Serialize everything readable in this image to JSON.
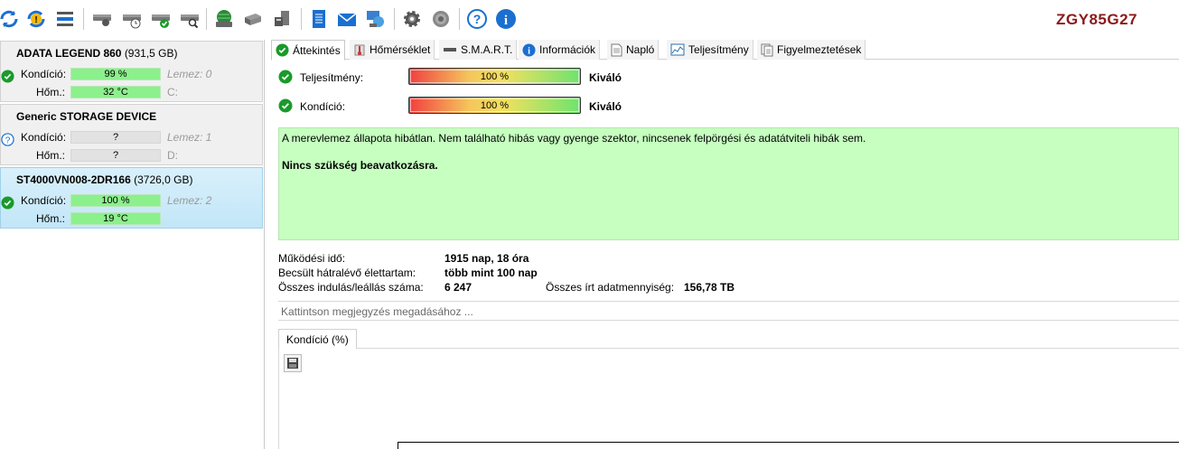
{
  "brand": "ZGY85G27",
  "toolbar": {
    "icons": [
      "refresh-icon",
      "refresh-warning-icon",
      "drive-list-icon",
      "drive-settings-icon",
      "drive-schedule-icon",
      "drive-check-icon",
      "drive-search-icon",
      "globe-drive-icon",
      "drive-tools-icon",
      "drive-cleanup-icon",
      "notes-icon",
      "email-icon",
      "network-icon",
      "gear-icon",
      "sound-icon",
      "help-icon",
      "info-icon"
    ]
  },
  "disks": [
    {
      "name": "ADATA LEGEND 860",
      "size": "(931,5 GB)",
      "status": "ok",
      "condition_label": "Kondíció:",
      "condition_value": "99 %",
      "temp_label": "Hőm.:",
      "temp_value": "32 °C",
      "disk_label": "Lemez: 0",
      "drive_letter": "C:"
    },
    {
      "name": "Generic STORAGE DEVICE",
      "size": "",
      "status": "unknown",
      "condition_label": "Kondíció:",
      "condition_value": "?",
      "temp_label": "Hőm.:",
      "temp_value": "?",
      "disk_label": "Lemez: 1",
      "drive_letter": "D:"
    },
    {
      "name": "ST4000VN008-2DR166",
      "size": "(3726,0 GB)",
      "status": "ok",
      "condition_label": "Kondíció:",
      "condition_value": "100 %",
      "temp_label": "Hőm.:",
      "temp_value": "19 °C",
      "disk_label": "Lemez: 2",
      "drive_letter": ""
    }
  ],
  "tabs": [
    "Áttekintés",
    "Hőmérséklet",
    "S.M.A.R.T.",
    "Információk",
    "Napló",
    "Teljesítmény",
    "Figyelmeztetések"
  ],
  "overview": {
    "performance_label": "Teljesítmény:",
    "performance_value": "100 %",
    "performance_rating": "Kiváló",
    "condition_label": "Kondíció:",
    "condition_value": "100 %",
    "condition_rating": "Kiváló",
    "status_text": "A merevlemez állapota hibátlan. Nem található hibás vagy gyenge szektor, nincsenek felpörgési és adatátviteli hibák sem.",
    "advice_text": "Nincs szükség beavatkozásra."
  },
  "stats": {
    "uptime_label": "Működési idő:",
    "uptime_value": "1915 nap, 18 óra",
    "lifetime_label": "Becsült hátralévő élettartam:",
    "lifetime_value": "több mint 100 nap",
    "starts_label": "Összes indulás/leállás száma:",
    "starts_value": "6 247",
    "written_label": "Összes írt adatmennyiség:",
    "written_value": "156,78 TB"
  },
  "note_placeholder": "Kattintson megjegyzés megadásához ...",
  "subtab_label": "Kondíció  (%)",
  "colors": {
    "ok_green": "#1a9a2a",
    "status_bg": "#c6ffc0",
    "brand": "#8b1a1a",
    "selected": "#c2e6f8"
  }
}
